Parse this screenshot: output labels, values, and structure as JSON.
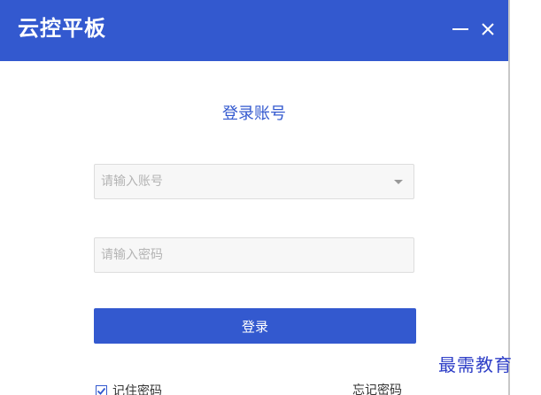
{
  "app": {
    "title": "云控平板"
  },
  "window_controls": {
    "minimize_icon": "minimize-icon",
    "close_icon": "close-icon"
  },
  "login": {
    "heading": "登录账号",
    "account_placeholder": "请输入账号",
    "password_placeholder": "请输入密码",
    "submit_label": "登录",
    "remember_label": "记住密码",
    "remember_checked": true,
    "forgot_label": "忘记密码"
  },
  "watermark": {
    "text": "最需教育"
  },
  "colors": {
    "accent": "#3359cf",
    "watermark": "#2f3fc7"
  }
}
